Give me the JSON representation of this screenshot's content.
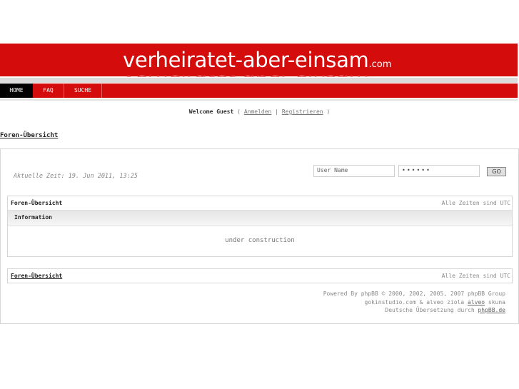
{
  "banner": {
    "logo_main": "verheiratet-aber-einsam",
    "logo_tld": ".com"
  },
  "nav": {
    "home": "HOME",
    "faq": "FAQ",
    "suche": "SUCHE"
  },
  "welcome": {
    "text": "Welcome Guest",
    "open": "(",
    "login": "Anmelden",
    "sep": "|",
    "register": "Registrieren",
    "close": ")"
  },
  "breadcrumb": "Foren-Übersicht",
  "time_text": "Aktuelle Zeit: 19. Jun 2011, 13:25",
  "login": {
    "user_placeholder": "User Name",
    "password_value": "••••••",
    "go_label": "GO"
  },
  "panel_top": {
    "title": "Foren-Übersicht",
    "timezone": "Alle Zeiten sind UTC",
    "info_header": "Information",
    "message": "under construction"
  },
  "panel_bottom": {
    "title": "Foren-Übersicht",
    "timezone": "Alle Zeiten sind UTC"
  },
  "footer": {
    "line1": "Powered By phpBB © 2000, 2002, 2005, 2007 phpBB Group",
    "line2_pre": "gokinstudio.com & alveo ziola ",
    "line2_link": "alveo",
    "line2_post": " skuna",
    "line3_pre": "Deutsche Übersetzung durch ",
    "line3_link": "phpBB.de"
  }
}
